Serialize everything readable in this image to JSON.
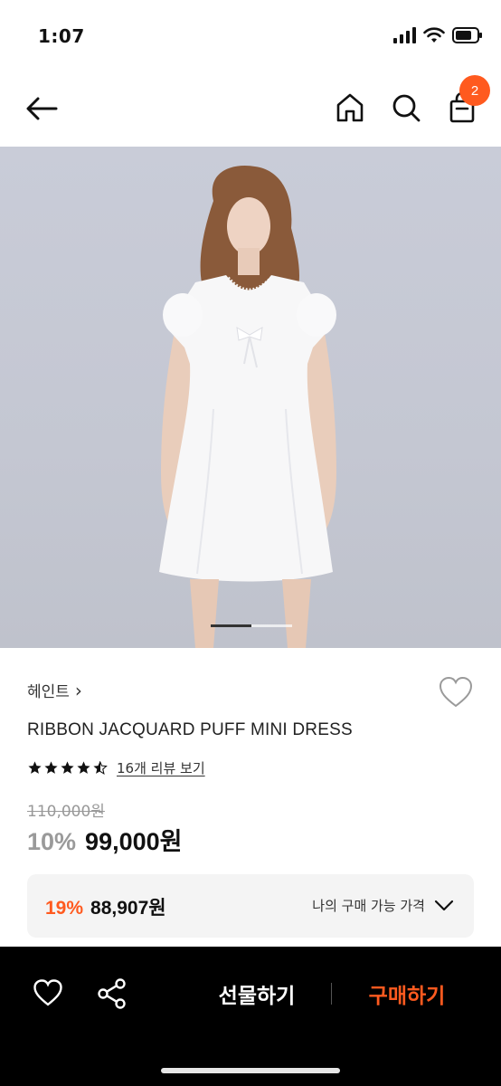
{
  "status_bar": {
    "time": "1:07"
  },
  "nav": {
    "cart_count": "2"
  },
  "product": {
    "brand": "헤인트",
    "brand_chevron": "›",
    "name": "RIBBON JACQUARD PUFF MINI DRESS",
    "rating_stars": 4.5,
    "review_link": "16개 리뷰 보기",
    "original_price": "110,000원",
    "discount_rate": "10%",
    "sale_price": "99,000원",
    "image_count": 2,
    "current_image": 1
  },
  "my_price": {
    "rate": "19%",
    "price": "88,907원",
    "label": "나의 구매 가능 가격"
  },
  "bottom_bar": {
    "gift_label": "선물하기",
    "buy_label": "구매하기"
  },
  "colors": {
    "accent": "#ff5a1f",
    "bottom_bar_bg": "#000000",
    "price_box_bg": "#f4f4f4"
  },
  "icons": [
    "back-arrow-icon",
    "home-icon",
    "search-icon",
    "shopping-bag-icon",
    "heart-icon",
    "star-icon",
    "chevron-down-icon",
    "share-icon"
  ]
}
